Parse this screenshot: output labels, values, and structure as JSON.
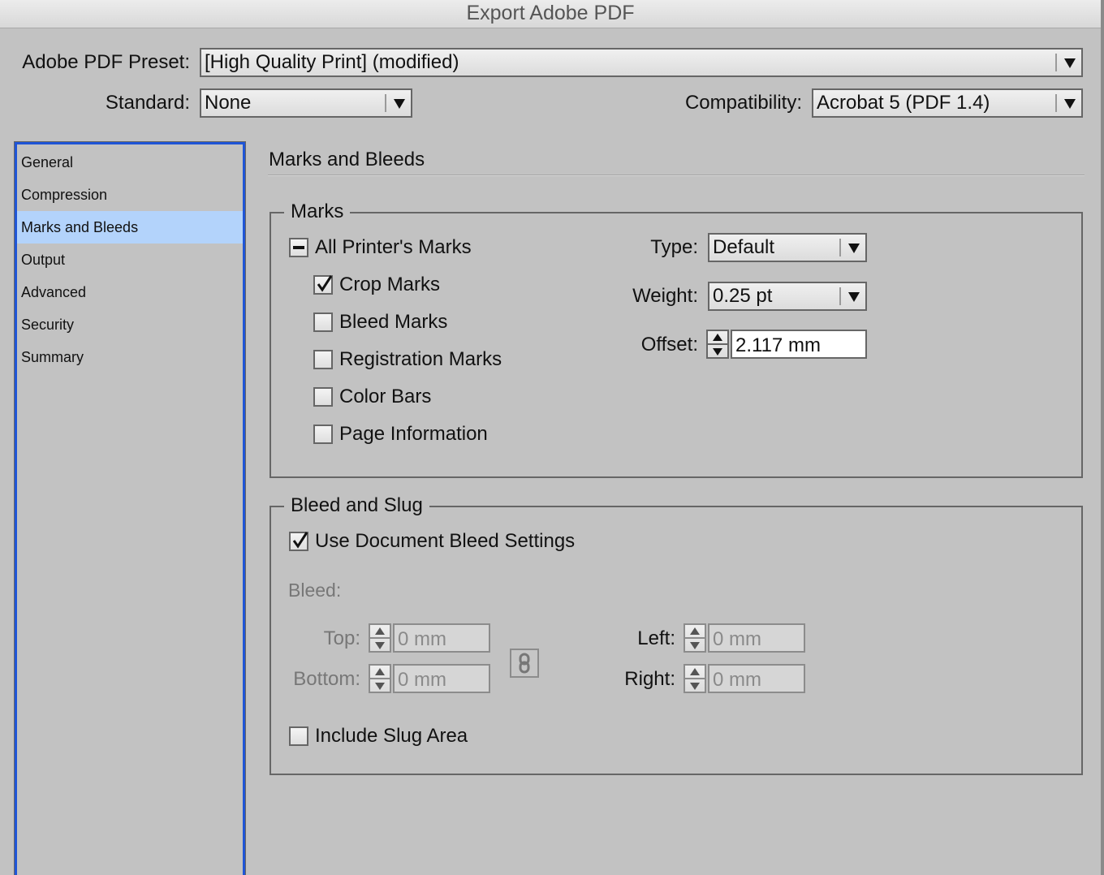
{
  "window": {
    "title": "Export Adobe PDF"
  },
  "header": {
    "preset_label": "Adobe PDF Preset:",
    "preset_value": "[High Quality Print] (modified)",
    "standard_label": "Standard:",
    "standard_value": "None",
    "compat_label": "Compatibility:",
    "compat_value": "Acrobat 5 (PDF 1.4)"
  },
  "sidebar": {
    "items": [
      {
        "label": "General",
        "active": false
      },
      {
        "label": "Compression",
        "active": false
      },
      {
        "label": "Marks and Bleeds",
        "active": true
      },
      {
        "label": "Output",
        "active": false
      },
      {
        "label": "Advanced",
        "active": false
      },
      {
        "label": "Security",
        "active": false
      },
      {
        "label": "Summary",
        "active": false
      }
    ],
    "accent_color": "#1f55d6",
    "selected_color": "#b3d3fb"
  },
  "main": {
    "section_title": "Marks and Bleeds",
    "marks": {
      "legend": "Marks",
      "all_printers_marks": {
        "label": "All Printer's Marks",
        "state": "mixed"
      },
      "checkboxes": [
        {
          "label": "Crop Marks",
          "checked": true
        },
        {
          "label": "Bleed Marks",
          "checked": false
        },
        {
          "label": "Registration Marks",
          "checked": false
        },
        {
          "label": "Color Bars",
          "checked": false
        },
        {
          "label": "Page Information",
          "checked": false
        }
      ],
      "type_label": "Type:",
      "type_value": "Default",
      "weight_label": "Weight:",
      "weight_value": "0.25 pt",
      "offset_label": "Offset:",
      "offset_value": "2.117 mm"
    },
    "bleed_slug": {
      "legend": "Bleed and Slug",
      "use_doc_bleed": {
        "label": "Use Document Bleed Settings",
        "checked": true
      },
      "bleed_label": "Bleed:",
      "top_label": "Top:",
      "top_value": "0 mm",
      "bottom_label": "Bottom:",
      "bottom_value": "0 mm",
      "left_label": "Left:",
      "left_value": "0 mm",
      "right_label": "Right:",
      "right_value": "0 mm",
      "link_icon": "chain-link-icon",
      "include_slug": {
        "label": "Include Slug Area",
        "checked": false
      }
    }
  }
}
